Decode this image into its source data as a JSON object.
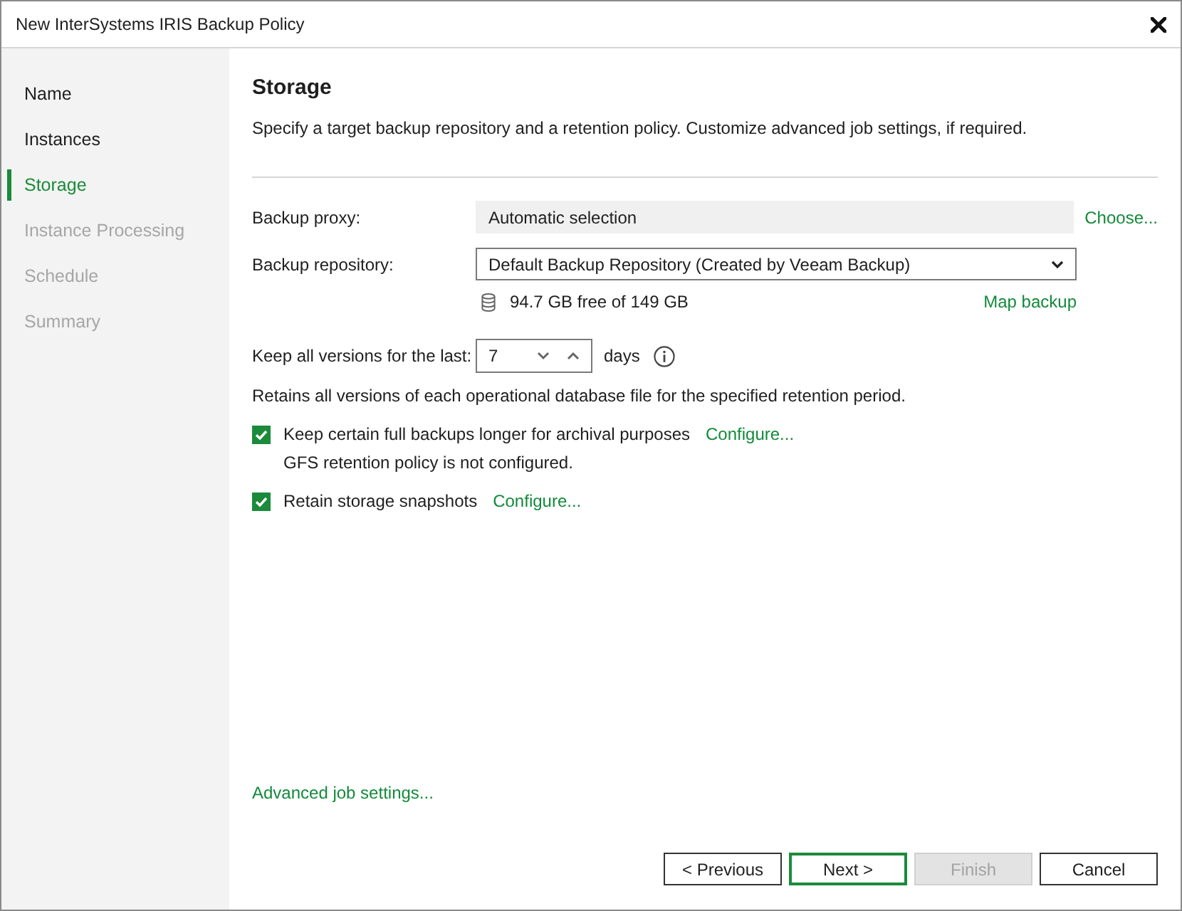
{
  "window": {
    "title": "New InterSystems IRIS Backup Policy"
  },
  "sidebar": {
    "items": [
      {
        "label": "Name",
        "selected": false,
        "disabled": false
      },
      {
        "label": "Instances",
        "selected": false,
        "disabled": false
      },
      {
        "label": "Storage",
        "selected": true,
        "disabled": false
      },
      {
        "label": "Instance Processing",
        "selected": false,
        "disabled": true
      },
      {
        "label": "Schedule",
        "selected": false,
        "disabled": true
      },
      {
        "label": "Summary",
        "selected": false,
        "disabled": true
      }
    ]
  },
  "page": {
    "title": "Storage",
    "description": "Specify a target backup repository and a retention policy. Customize advanced job settings, if required."
  },
  "form": {
    "backup_proxy": {
      "label": "Backup proxy:",
      "value": "Automatic selection",
      "link": "Choose..."
    },
    "backup_repository": {
      "label": "Backup repository:",
      "value": "Default Backup Repository (Created by Veeam Backup)",
      "free_space": "94.7 GB free of 149 GB",
      "link": "Map backup"
    },
    "retention": {
      "label": "Keep all versions for the last:",
      "value": "7",
      "unit": "days",
      "note": "Retains all versions of each operational database file for the specified retention period."
    },
    "options": [
      {
        "label": "Keep certain full backups longer for archival purposes",
        "checked": true,
        "link": "Configure...",
        "note": "GFS retention policy is not configured."
      },
      {
        "label": "Retain storage snapshots",
        "checked": true,
        "link": "Configure..."
      }
    ]
  },
  "advanced_link": "Advanced job settings...",
  "buttons": [
    {
      "label": "< Previous",
      "default": false,
      "disabled": false
    },
    {
      "label": "Next >",
      "default": true,
      "disabled": false
    },
    {
      "label": "Finish",
      "default": false,
      "disabled": true
    },
    {
      "label": "Cancel",
      "default": false,
      "disabled": false
    }
  ]
}
